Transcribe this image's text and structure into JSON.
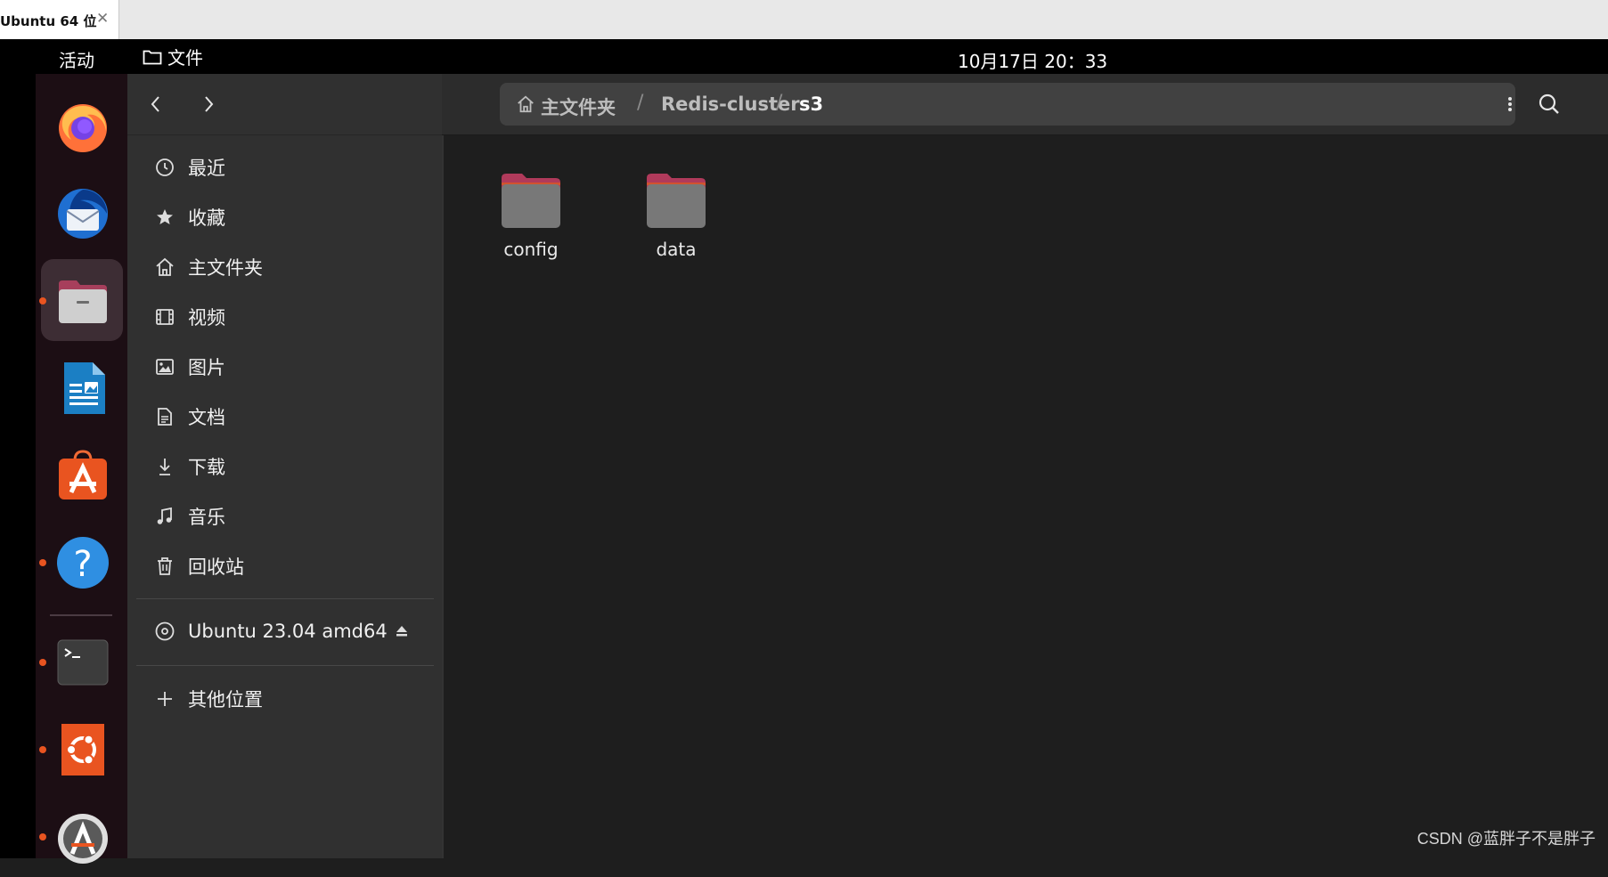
{
  "host": {
    "tab_title": "Ubuntu 64 位",
    "close_glyph": "✕"
  },
  "topbar": {
    "activities": "活动",
    "app_menu": "文件",
    "app_menu_icon": "folder-icon",
    "clock": "10月17日  20：33"
  },
  "dock": {
    "items": [
      {
        "name": "firefox",
        "icon": "firefox-icon",
        "running": false,
        "active": false
      },
      {
        "name": "thunderbird",
        "icon": "thunderbird-icon",
        "running": false,
        "active": false
      },
      {
        "name": "files",
        "icon": "files-icon",
        "running": true,
        "active": true
      },
      {
        "name": "libreoffice-writer",
        "icon": "writer-icon",
        "running": false,
        "active": false
      },
      {
        "name": "app-center",
        "icon": "app-center-icon",
        "running": false,
        "active": false
      },
      {
        "name": "help",
        "icon": "help-icon",
        "running": true,
        "active": false
      },
      {
        "name": "terminal",
        "icon": "terminal-icon",
        "running": true,
        "active": false
      },
      {
        "name": "ubuntu-installer",
        "icon": "ubuntu-icon",
        "running": true,
        "active": false
      },
      {
        "name": "software-updater",
        "icon": "updater-icon",
        "running": true,
        "active": false
      }
    ]
  },
  "sidebar": {
    "items": [
      {
        "label": "最近",
        "icon": "clock-icon"
      },
      {
        "label": "收藏",
        "icon": "star-icon"
      },
      {
        "label": "主文件夹",
        "icon": "home-icon"
      },
      {
        "label": "视频",
        "icon": "film-icon"
      },
      {
        "label": "图片",
        "icon": "image-icon"
      },
      {
        "label": "文档",
        "icon": "document-icon"
      },
      {
        "label": "下载",
        "icon": "download-icon"
      },
      {
        "label": "音乐",
        "icon": "music-icon"
      },
      {
        "label": "回收站",
        "icon": "trash-icon"
      }
    ],
    "device": {
      "label": "Ubuntu 23.04 amd64",
      "icon": "disc-icon",
      "eject_icon": "eject-icon"
    },
    "other": {
      "label": "其他位置",
      "icon": "plus-icon"
    }
  },
  "pathbar": {
    "crumbs": [
      "主文件夹",
      "Redis-cluster",
      "s3"
    ],
    "separator": "/"
  },
  "files": [
    {
      "name": "config",
      "type": "folder"
    },
    {
      "name": "data",
      "type": "folder"
    }
  ],
  "watermark": "CSDN @蓝胖子不是胖子",
  "colors": {
    "accent": "#e95420",
    "folder_tab": "#b03a5b",
    "folder_body": "#757575",
    "sidebar_bg": "#303030",
    "content_bg": "#1e1e1e"
  }
}
